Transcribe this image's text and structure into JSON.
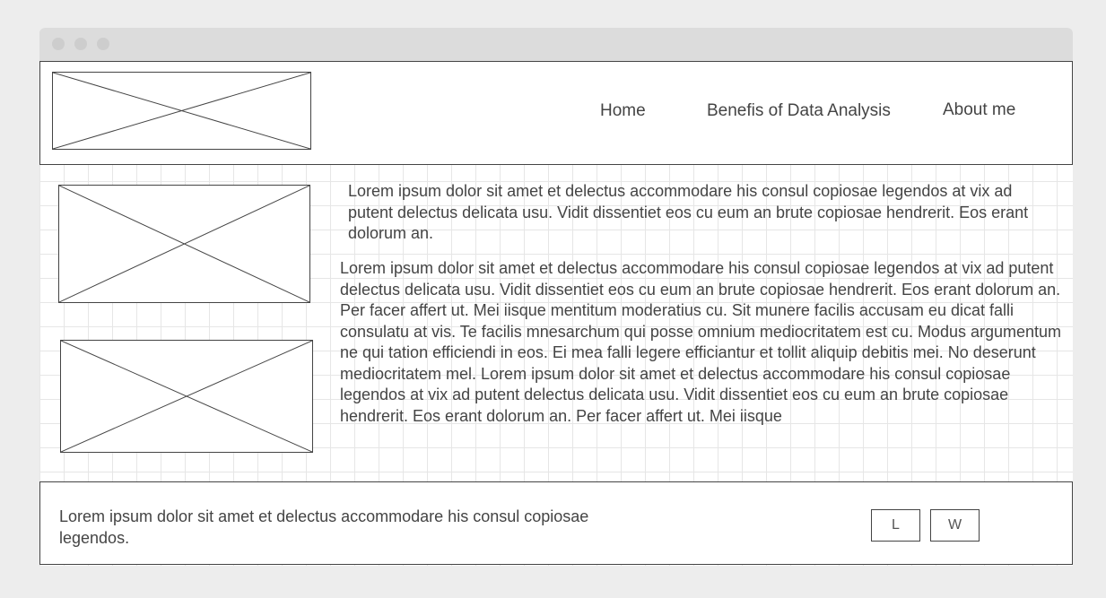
{
  "window": {
    "dots": [
      "close",
      "minimize",
      "maximize"
    ]
  },
  "header": {
    "logo": "image-placeholder",
    "nav": [
      "Home",
      "Benefis of Data Analysis",
      "About me"
    ]
  },
  "main": {
    "images": [
      "image-placeholder",
      "image-placeholder"
    ],
    "intro": "Lorem ipsum dolor sit amet et delectus accommodare his consul copiosae legendos at vix ad putent delectus delicata usu. Vidit dissentiet eos cu eum an brute copiosae hendrerit. Eos erant dolorum an.",
    "body": "Lorem ipsum dolor sit amet et delectus accommodare his consul copiosae legendos at vix ad putent delectus delicata usu. Vidit dissentiet eos cu eum an brute copiosae hendrerit. Eos erant dolorum an. Per facer affert ut. Mei iisque mentitum moderatius cu. Sit munere facilis accusam eu dicat falli consulatu at vis. Te facilis mnesarchum qui posse omnium mediocritatem est cu. Modus argumentum ne qui tation efficiendi in eos. Ei mea falli legere efficiantur et tollit aliquip debitis mei. No deserunt mediocritatem mel. Lorem ipsum dolor sit amet et delectus accommodare his consul copiosae legendos at vix ad putent delectus delicata usu. Vidit dissentiet eos cu eum an brute copiosae hendrerit. Eos erant dolorum an. Per facer affert ut. Mei iisque"
  },
  "footer": {
    "text": "Lorem ipsum dolor sit amet et delectus accommodare his consul copiosae legendos.",
    "buttons": [
      "L",
      "W"
    ]
  }
}
